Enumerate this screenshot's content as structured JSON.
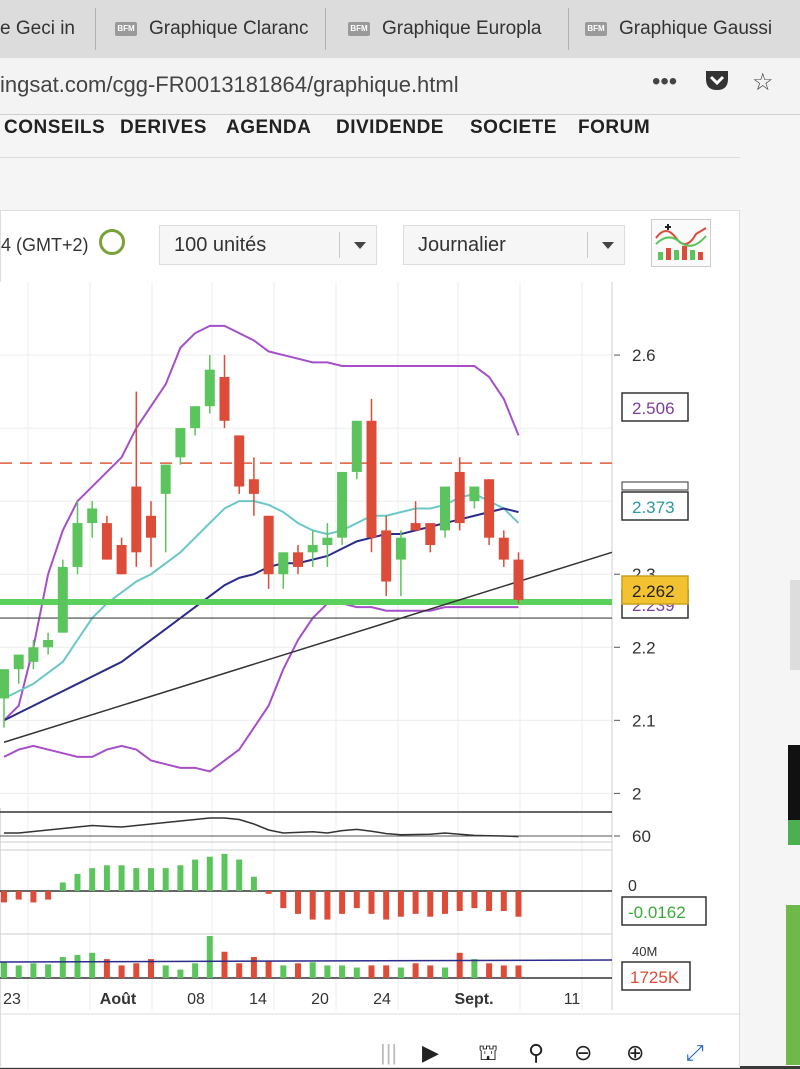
{
  "tabs": [
    {
      "label": "e Geci in",
      "x": 0,
      "w": 85
    },
    {
      "label": "Graphique Claranc",
      "x": 115,
      "w": 200
    },
    {
      "label": "Graphique Europla",
      "x": 348,
      "w": 210
    },
    {
      "label": "Graphique Gaussi",
      "x": 585,
      "w": 215
    }
  ],
  "favicon_text": "BFM",
  "url": "ingsat.com/cgg-FR0013181864/graphique.html",
  "nav": [
    "CONSEILS",
    "DERIVES",
    "AGENDA",
    "DIVIDENDE",
    "SOCIETE",
    "FORUM"
  ],
  "toolbar": {
    "timezone": "4 (GMT+2)",
    "units": "100 unités",
    "period": "Journalier"
  },
  "colors": {
    "up": "#5cc45c",
    "down": "#dd4b39",
    "bollinger": "#a64fc8",
    "ma_short": "#6cc7c7",
    "ma_long": "#2b2b8c",
    "support": "#5cd05c",
    "resistance": "#e05a3a"
  },
  "chart_data": {
    "type": "candlestick",
    "ylim": [
      1.98,
      2.7
    ],
    "y_ticks": [
      "2",
      "2.1",
      "2.2",
      "2.3",
      "2.6"
    ],
    "x_tick_labels": [
      "23",
      "Août",
      "08",
      "14",
      "20",
      "24",
      "Sept.",
      "11"
    ],
    "tags": {
      "upper_band": "2.506",
      "moving_average": "2.373",
      "last": "2.262",
      "lower_band": "2.239"
    },
    "candles": [
      {
        "o": 2.13,
        "h": 2.14,
        "l": 2.09,
        "c": 2.17
      },
      {
        "o": 2.17,
        "h": 2.19,
        "l": 2.15,
        "c": 2.19
      },
      {
        "o": 2.18,
        "h": 2.21,
        "l": 2.17,
        "c": 2.2
      },
      {
        "o": 2.2,
        "h": 2.22,
        "l": 2.19,
        "c": 2.21
      },
      {
        "o": 2.22,
        "h": 2.32,
        "l": 2.22,
        "c": 2.31
      },
      {
        "o": 2.31,
        "h": 2.4,
        "l": 2.3,
        "c": 2.37
      },
      {
        "o": 2.37,
        "h": 2.4,
        "l": 2.35,
        "c": 2.39
      },
      {
        "o": 2.37,
        "h": 2.38,
        "l": 2.33,
        "c": 2.32
      },
      {
        "o": 2.34,
        "h": 2.35,
        "l": 2.3,
        "c": 2.3
      },
      {
        "o": 2.42,
        "h": 2.55,
        "l": 2.31,
        "c": 2.33
      },
      {
        "o": 2.38,
        "h": 2.4,
        "l": 2.31,
        "c": 2.35
      },
      {
        "o": 2.41,
        "h": 2.44,
        "l": 2.33,
        "c": 2.45
      },
      {
        "o": 2.46,
        "h": 2.49,
        "l": 2.45,
        "c": 2.5
      },
      {
        "o": 2.5,
        "h": 2.53,
        "l": 2.49,
        "c": 2.53
      },
      {
        "o": 2.53,
        "h": 2.6,
        "l": 2.52,
        "c": 2.58
      },
      {
        "o": 2.57,
        "h": 2.6,
        "l": 2.5,
        "c": 2.51
      },
      {
        "o": 2.49,
        "h": 2.49,
        "l": 2.41,
        "c": 2.42
      },
      {
        "o": 2.43,
        "h": 2.46,
        "l": 2.38,
        "c": 2.41
      },
      {
        "o": 2.38,
        "h": 2.38,
        "l": 2.28,
        "c": 2.3
      },
      {
        "o": 2.3,
        "h": 2.33,
        "l": 2.28,
        "c": 2.33
      },
      {
        "o": 2.33,
        "h": 2.34,
        "l": 2.3,
        "c": 2.31
      },
      {
        "o": 2.33,
        "h": 2.36,
        "l": 2.31,
        "c": 2.34
      },
      {
        "o": 2.34,
        "h": 2.37,
        "l": 2.31,
        "c": 2.35
      },
      {
        "o": 2.35,
        "h": 2.42,
        "l": 2.34,
        "c": 2.44
      },
      {
        "o": 2.44,
        "h": 2.51,
        "l": 2.43,
        "c": 2.51
      },
      {
        "o": 2.51,
        "h": 2.54,
        "l": 2.33,
        "c": 2.35
      },
      {
        "o": 2.36,
        "h": 2.38,
        "l": 2.27,
        "c": 2.29
      },
      {
        "o": 2.32,
        "h": 2.36,
        "l": 2.27,
        "c": 2.35
      },
      {
        "o": 2.37,
        "h": 2.4,
        "l": 2.36,
        "c": 2.36
      },
      {
        "o": 2.37,
        "h": 2.37,
        "l": 2.33,
        "c": 2.34
      },
      {
        "o": 2.36,
        "h": 2.42,
        "l": 2.35,
        "c": 2.42
      },
      {
        "o": 2.44,
        "h": 2.46,
        "l": 2.36,
        "c": 2.37
      },
      {
        "o": 2.4,
        "h": 2.41,
        "l": 2.39,
        "c": 2.42
      },
      {
        "o": 2.43,
        "h": 2.43,
        "l": 2.34,
        "c": 2.35
      },
      {
        "o": 2.35,
        "h": 2.36,
        "l": 2.31,
        "c": 2.32
      },
      {
        "o": 2.32,
        "h": 2.33,
        "l": 2.26,
        "c": 2.265
      }
    ],
    "ma_short": [
      2.13,
      2.14,
      2.15,
      2.165,
      2.18,
      2.21,
      2.24,
      2.26,
      2.275,
      2.29,
      2.3,
      2.315,
      2.33,
      2.35,
      2.37,
      2.39,
      2.4,
      2.4,
      2.395,
      2.385,
      2.37,
      2.36,
      2.355,
      2.36,
      2.37,
      2.38,
      2.38,
      2.385,
      2.39,
      2.39,
      2.395,
      2.405,
      2.41,
      2.4,
      2.39,
      2.37
    ],
    "ma_long": [
      2.1,
      2.11,
      2.12,
      2.13,
      2.14,
      2.15,
      2.16,
      2.17,
      2.18,
      2.195,
      2.21,
      2.225,
      2.24,
      2.255,
      2.27,
      2.285,
      2.295,
      2.3,
      2.31,
      2.315,
      2.315,
      2.32,
      2.325,
      2.335,
      2.345,
      2.35,
      2.355,
      2.355,
      2.36,
      2.365,
      2.37,
      2.375,
      2.38,
      2.385,
      2.39,
      2.385
    ],
    "boll_upper": [
      2.1,
      2.12,
      2.2,
      2.3,
      2.36,
      2.4,
      2.42,
      2.44,
      2.46,
      2.5,
      2.53,
      2.56,
      2.61,
      2.63,
      2.64,
      2.64,
      2.63,
      2.62,
      2.605,
      2.6,
      2.595,
      2.59,
      2.59,
      2.585,
      2.585,
      2.585,
      2.585,
      2.585,
      2.585,
      2.585,
      2.585,
      2.585,
      2.585,
      2.57,
      2.54,
      2.49
    ],
    "boll_lower": [
      2.05,
      2.06,
      2.065,
      2.06,
      2.055,
      2.05,
      2.05,
      2.06,
      2.065,
      2.06,
      2.045,
      2.04,
      2.035,
      2.035,
      2.03,
      2.045,
      2.06,
      2.09,
      2.12,
      2.17,
      2.21,
      2.24,
      2.26,
      2.26,
      2.255,
      2.255,
      2.25,
      2.25,
      2.25,
      2.25,
      2.255,
      2.255,
      2.255,
      2.255,
      2.255,
      2.255
    ],
    "resistance": 2.452,
    "support": 2.262,
    "support2": 2.24,
    "trendline": {
      "from": [
        0,
        2.07
      ],
      "to": [
        36,
        2.33
      ]
    },
    "oscillator": {
      "tick": "60",
      "values": [
        61,
        61,
        61.5,
        62,
        62.5,
        63,
        63.5,
        63.2,
        63,
        63.5,
        64,
        64.5,
        65,
        65.5,
        66,
        66,
        65.5,
        64,
        62,
        61,
        61.2,
        61.4,
        61,
        61.8,
        62.2,
        61.6,
        60.8,
        60.4,
        60.5,
        60.6,
        61,
        60.6,
        60.2,
        60.1,
        60,
        59.8
      ]
    },
    "macd": {
      "tick": "0",
      "last": "-0.0162",
      "values": [
        -0.004,
        -0.003,
        -0.004,
        -0.003,
        0.003,
        0.006,
        0.008,
        0.009,
        0.009,
        0.008,
        0.008,
        0.008,
        0.009,
        0.011,
        0.012,
        0.013,
        0.011,
        0.005,
        -0.001,
        -0.006,
        -0.008,
        -0.01,
        -0.01,
        -0.008,
        -0.006,
        -0.008,
        -0.01,
        -0.009,
        -0.008,
        -0.009,
        -0.008,
        -0.007,
        -0.006,
        -0.007,
        -0.007,
        -0.009
      ]
    },
    "volume": {
      "tick": "40M",
      "last": "1725K",
      "values": [
        15,
        12,
        14,
        13,
        20,
        22,
        24,
        18,
        12,
        14,
        18,
        12,
        8,
        14,
        40,
        25,
        14,
        20,
        16,
        12,
        14,
        15,
        12,
        12,
        10,
        12,
        12,
        10,
        14,
        12,
        10,
        24,
        18,
        14,
        12,
        12
      ]
    }
  }
}
